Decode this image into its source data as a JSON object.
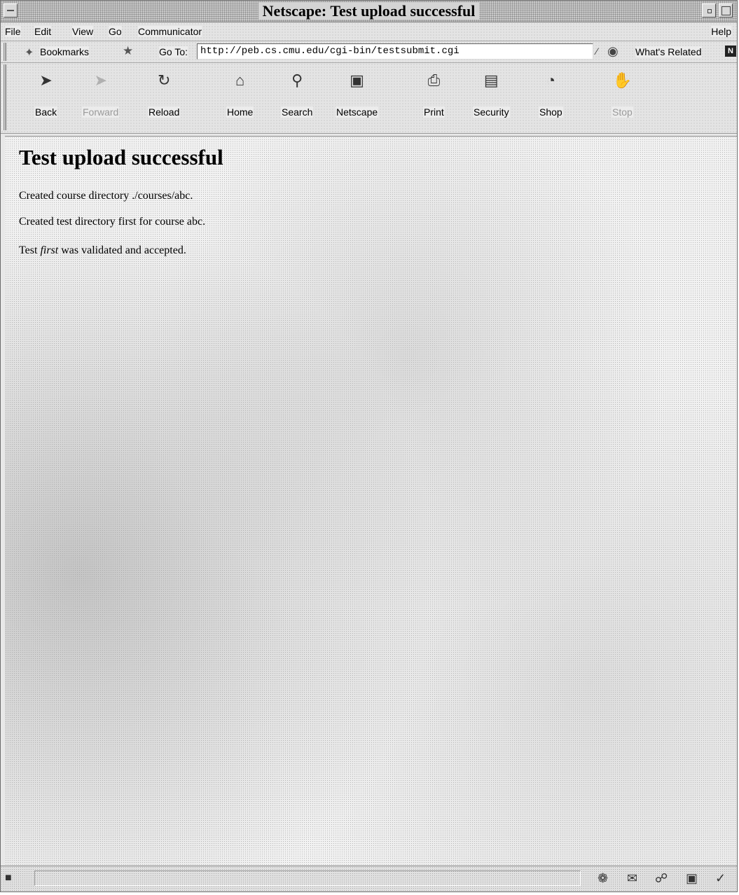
{
  "window": {
    "title": "Netscape: Test upload successful"
  },
  "menubar": {
    "items": [
      "File",
      "Edit",
      "View",
      "Go",
      "Communicator"
    ],
    "help": "Help"
  },
  "location": {
    "bookmarks_label": "Bookmarks",
    "goto_label": "Go To:",
    "url": "http://peb.cs.cmu.edu/cgi-bin/testsubmit.cgi",
    "related_label": "What's Related"
  },
  "toolbar": {
    "buttons": [
      {
        "label": "Back",
        "icon": "back-arrow-icon",
        "enabled": true
      },
      {
        "label": "Forward",
        "icon": "forward-arrow-icon",
        "enabled": false
      },
      {
        "label": "Reload",
        "icon": "reload-icon",
        "enabled": true
      },
      {
        "label": "Home",
        "icon": "home-icon",
        "enabled": true
      },
      {
        "label": "Search",
        "icon": "search-icon",
        "enabled": true
      },
      {
        "label": "Netscape",
        "icon": "netscape-icon",
        "enabled": true
      },
      {
        "label": "Print",
        "icon": "print-icon",
        "enabled": true
      },
      {
        "label": "Security",
        "icon": "security-lock-icon",
        "enabled": true
      },
      {
        "label": "Shop",
        "icon": "shop-icon",
        "enabled": true
      },
      {
        "label": "Stop",
        "icon": "stop-icon",
        "enabled": false
      }
    ]
  },
  "page": {
    "heading": "Test upload successful",
    "line1": "Created course directory ./courses/abc.",
    "line2": "Created test directory first for course abc.",
    "line3_prefix": "Test ",
    "line3_emph": "first",
    "line3_suffix": " was validated and accepted."
  },
  "statusbar": {
    "text": "",
    "component_icons": [
      "navigator-icon",
      "mail-icon",
      "discussion-icon",
      "composer-icon",
      "edit-icon"
    ]
  }
}
